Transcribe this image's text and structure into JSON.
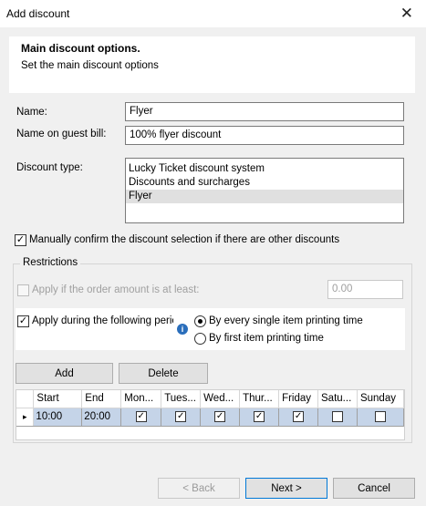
{
  "window": {
    "title": "Add discount",
    "close_glyph": "✕"
  },
  "header": {
    "title": "Main discount options.",
    "subtitle": "Set the main discount options"
  },
  "form": {
    "name_label": "Name:",
    "name_value": "Flyer",
    "bill_label": "Name on guest bill:",
    "bill_value": "100% flyer discount",
    "type_label": "Discount type:",
    "type_options": [
      "Lucky Ticket discount system",
      "Discounts and surcharges",
      "Flyer"
    ],
    "type_selected": "Flyer",
    "manual_confirm_label": "Manually confirm the discount selection if there are other discounts",
    "manual_confirm_checked": true
  },
  "restrictions": {
    "title": "Restrictions",
    "min_amount_label": "Apply if the order amount is at least:",
    "min_amount_checked": false,
    "min_amount_value": "0.00",
    "period_label": "Apply during the following perio",
    "period_checked": true,
    "radio_every_item": "By every single item printing time",
    "radio_first_item": "By first item printing time",
    "radio_selected": "every",
    "add_button": "Add",
    "delete_button": "Delete",
    "grid": {
      "columns": [
        "Start",
        "End",
        "Mon...",
        "Tues...",
        "Wed...",
        "Thur...",
        "Friday",
        "Satu...",
        "Sunday"
      ],
      "rows": [
        {
          "indicator": "▸",
          "start": "10:00",
          "end": "20:00",
          "days": [
            true,
            true,
            true,
            true,
            true,
            false,
            false
          ]
        }
      ]
    }
  },
  "footer": {
    "back": "< Back",
    "next": "Next >",
    "cancel": "Cancel"
  },
  "glyphs": {
    "check": "✓",
    "info": "i"
  }
}
